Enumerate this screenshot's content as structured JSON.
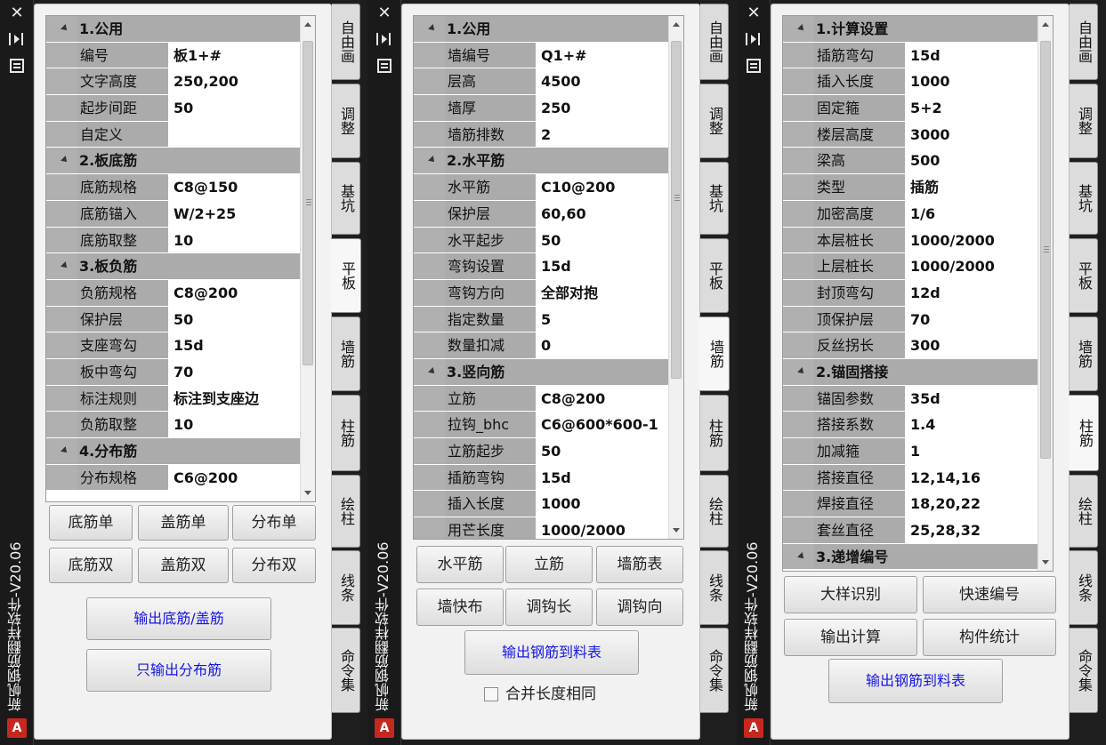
{
  "app_title": "新帆钢筋翻样软件-V20.06",
  "tab_labels": [
    "自由画",
    "调整",
    "基坑",
    "平板",
    "墙筋",
    "柱筋",
    "绘柱",
    "线条",
    "命令集"
  ],
  "palette1": {
    "active_tab": "平板",
    "groups": [
      {
        "name": "1.公用",
        "rows": [
          [
            "编号",
            "板1+#"
          ],
          [
            "文字高度",
            "250,200"
          ],
          [
            "起步间距",
            "50"
          ],
          [
            "自定义",
            ""
          ]
        ]
      },
      {
        "name": "2.板底筋",
        "rows": [
          [
            "底筋规格",
            "C8@150"
          ],
          [
            "底筋锚入",
            "W/2+25"
          ],
          [
            "底筋取整",
            "10"
          ]
        ]
      },
      {
        "name": "3.板负筋",
        "rows": [
          [
            "负筋规格",
            "C8@200"
          ],
          [
            "保护层",
            "50"
          ],
          [
            "支座弯勾",
            "15d"
          ],
          [
            "板中弯勾",
            "70"
          ],
          [
            "标注规则",
            "标注到支座边"
          ],
          [
            "负筋取整",
            "10"
          ]
        ]
      },
      {
        "name": "4.分布筋",
        "rows": [
          [
            "分布规格",
            "C6@200"
          ]
        ]
      }
    ],
    "buttons": [
      "底筋单",
      "盖筋单",
      "分布单",
      "底筋双",
      "盖筋双",
      "分布双"
    ],
    "blue_buttons": [
      "输出底筋/盖筋",
      "只输出分布筋"
    ]
  },
  "palette2": {
    "active_tab": "墙筋",
    "groups": [
      {
        "name": "1.公用",
        "rows": [
          [
            "墙编号",
            "Q1+#"
          ],
          [
            "层高",
            "4500"
          ],
          [
            "墙厚",
            "250"
          ],
          [
            "墙筋排数",
            "2"
          ]
        ]
      },
      {
        "name": "2.水平筋",
        "rows": [
          [
            "水平筋",
            "C10@200"
          ],
          [
            "保护层",
            "60,60"
          ],
          [
            "水平起步",
            "50"
          ],
          [
            "弯钩设置",
            "15d"
          ],
          [
            "弯钩方向",
            "全部对抱"
          ],
          [
            "指定数量",
            "5"
          ],
          [
            "数量扣减",
            "0"
          ]
        ]
      },
      {
        "name": "3.竖向筋",
        "rows": [
          [
            "立筋",
            "C8@200"
          ],
          [
            "拉钩_bhc",
            "C6@600*600-1"
          ],
          [
            "立筋起步",
            "50"
          ],
          [
            "插筋弯钩",
            "15d"
          ],
          [
            "插入长度",
            "1000"
          ],
          [
            "用芒长度",
            "1000/2000"
          ]
        ]
      }
    ],
    "buttons": [
      "水平筋",
      "立筋",
      "墙筋表",
      "墙快布",
      "调钩长",
      "调钩向"
    ],
    "blue_buttons": [
      "输出钢筋到料表"
    ],
    "checkbox_label": "合并长度相同"
  },
  "palette3": {
    "active_tab": "柱筋",
    "groups": [
      {
        "name": "1.计算设置",
        "rows": [
          [
            "插筋弯勾",
            "15d"
          ],
          [
            "插入长度",
            "1000"
          ],
          [
            "固定箍",
            "5+2"
          ],
          [
            "楼层高度",
            "3000"
          ],
          [
            "梁高",
            "500"
          ],
          [
            "类型",
            "插筋"
          ],
          [
            "加密高度",
            "1/6"
          ],
          [
            "本层桩长",
            "1000/2000"
          ],
          [
            "上层桩长",
            "1000/2000"
          ],
          [
            "封顶弯勾",
            "12d"
          ],
          [
            "顶保护层",
            "70"
          ],
          [
            "反丝拐长",
            "300"
          ]
        ]
      },
      {
        "name": "2.锚固搭接",
        "rows": [
          [
            "锚固参数",
            "35d"
          ],
          [
            "搭接系数",
            "1.4"
          ],
          [
            "加减箍",
            "1"
          ],
          [
            "搭接直径",
            "12,14,16"
          ],
          [
            "焊接直径",
            "18,20,22"
          ],
          [
            "套丝直径",
            "25,28,32"
          ]
        ]
      },
      {
        "name": "3.递增编号",
        "rows": []
      }
    ],
    "buttons": [
      "大样识别",
      "快速编号",
      "输出计算",
      "构件统计"
    ],
    "blue_buttons": [
      "输出钢筋到料表"
    ]
  }
}
